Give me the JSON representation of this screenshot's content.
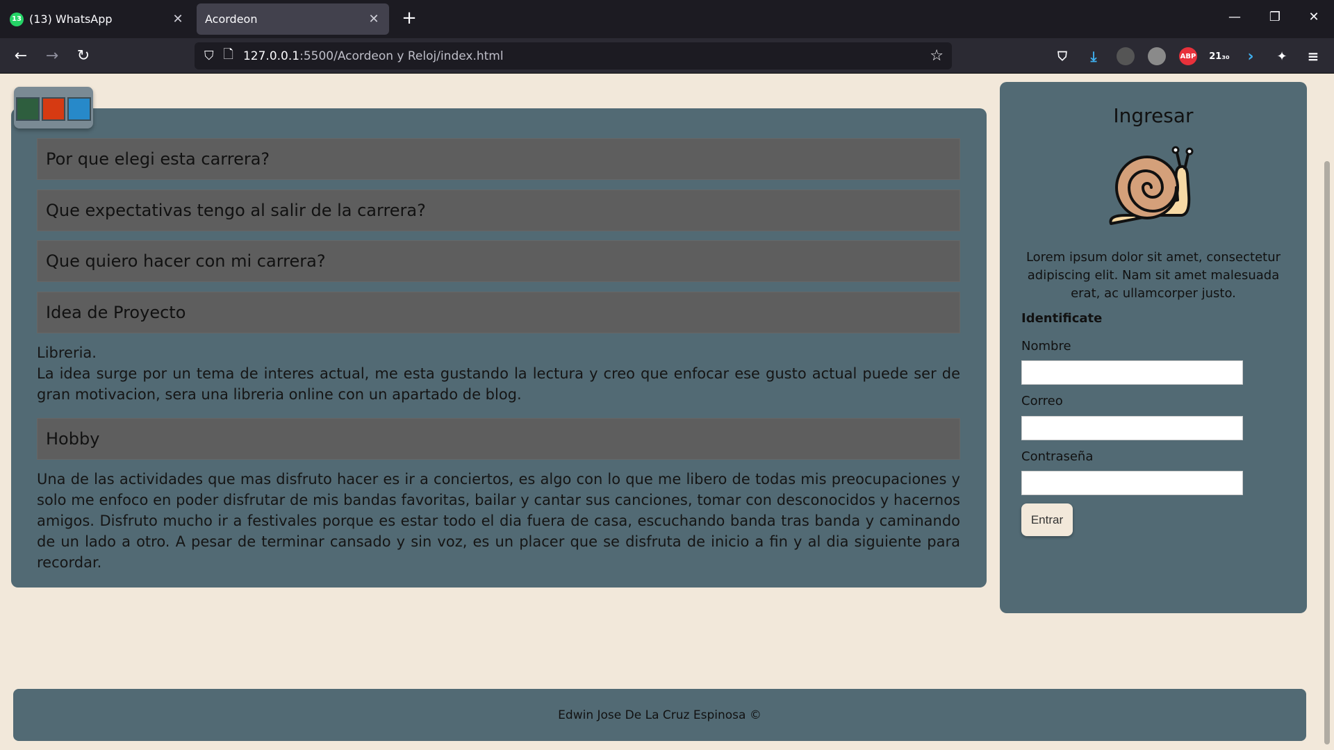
{
  "browser": {
    "tabs": [
      {
        "title": "(13) WhatsApp",
        "badge": "13"
      },
      {
        "title": "Acordeon"
      }
    ],
    "url_host": "127.0.0.1",
    "url_path": ":5500/Acordeon y Reloj/index.html",
    "extension_badges": {
      "abp": "ABP",
      "counter": "21₃₀"
    }
  },
  "theme_swatches": [
    "#2e5e3e",
    "#d63a12",
    "#2789c9"
  ],
  "accordion": {
    "items": [
      {
        "title": "Por que elegi esta carrera?"
      },
      {
        "title": "Que expectativas tengo al salir de la carrera?"
      },
      {
        "title": "Que quiero hacer con mi carrera?"
      },
      {
        "title": "Idea de Proyecto",
        "body_line1": "Libreria.",
        "body_line2": "La idea surge por un tema de interes actual, me esta gustando la lectura y creo que enfocar ese gusto actual puede ser de gran motivacion, sera una libreria online con un apartado de blog."
      },
      {
        "title": "Hobby",
        "body": "Una de las actividades que mas disfruto hacer es ir a conciertos, es algo con lo que me libero de todas mis preocupaciones y solo me enfoco en poder disfrutar de mis bandas favoritas, bailar y cantar sus canciones, tomar con desconocidos y hacernos amigos. Disfruto mucho ir a festivales porque es estar todo el dia fuera de casa, escuchando banda tras banda y caminando de un lado a otro. A pesar de terminar cansado y sin voz, es un placer que se disfruta de inicio a fin y al dia siguiente para recordar."
      }
    ]
  },
  "login": {
    "title": "Ingresar",
    "description": "Lorem ipsum dolor sit amet, consectetur adipiscing elit. Nam sit amet malesuada erat, ac ullamcorper justo.",
    "section_label": "Identificate",
    "fields": {
      "name_label": "Nombre",
      "email_label": "Correo",
      "password_label": "Contraseña"
    },
    "submit_label": "Entrar"
  },
  "footer": {
    "text": "Edwin Jose De La Cruz Espinosa ©"
  }
}
